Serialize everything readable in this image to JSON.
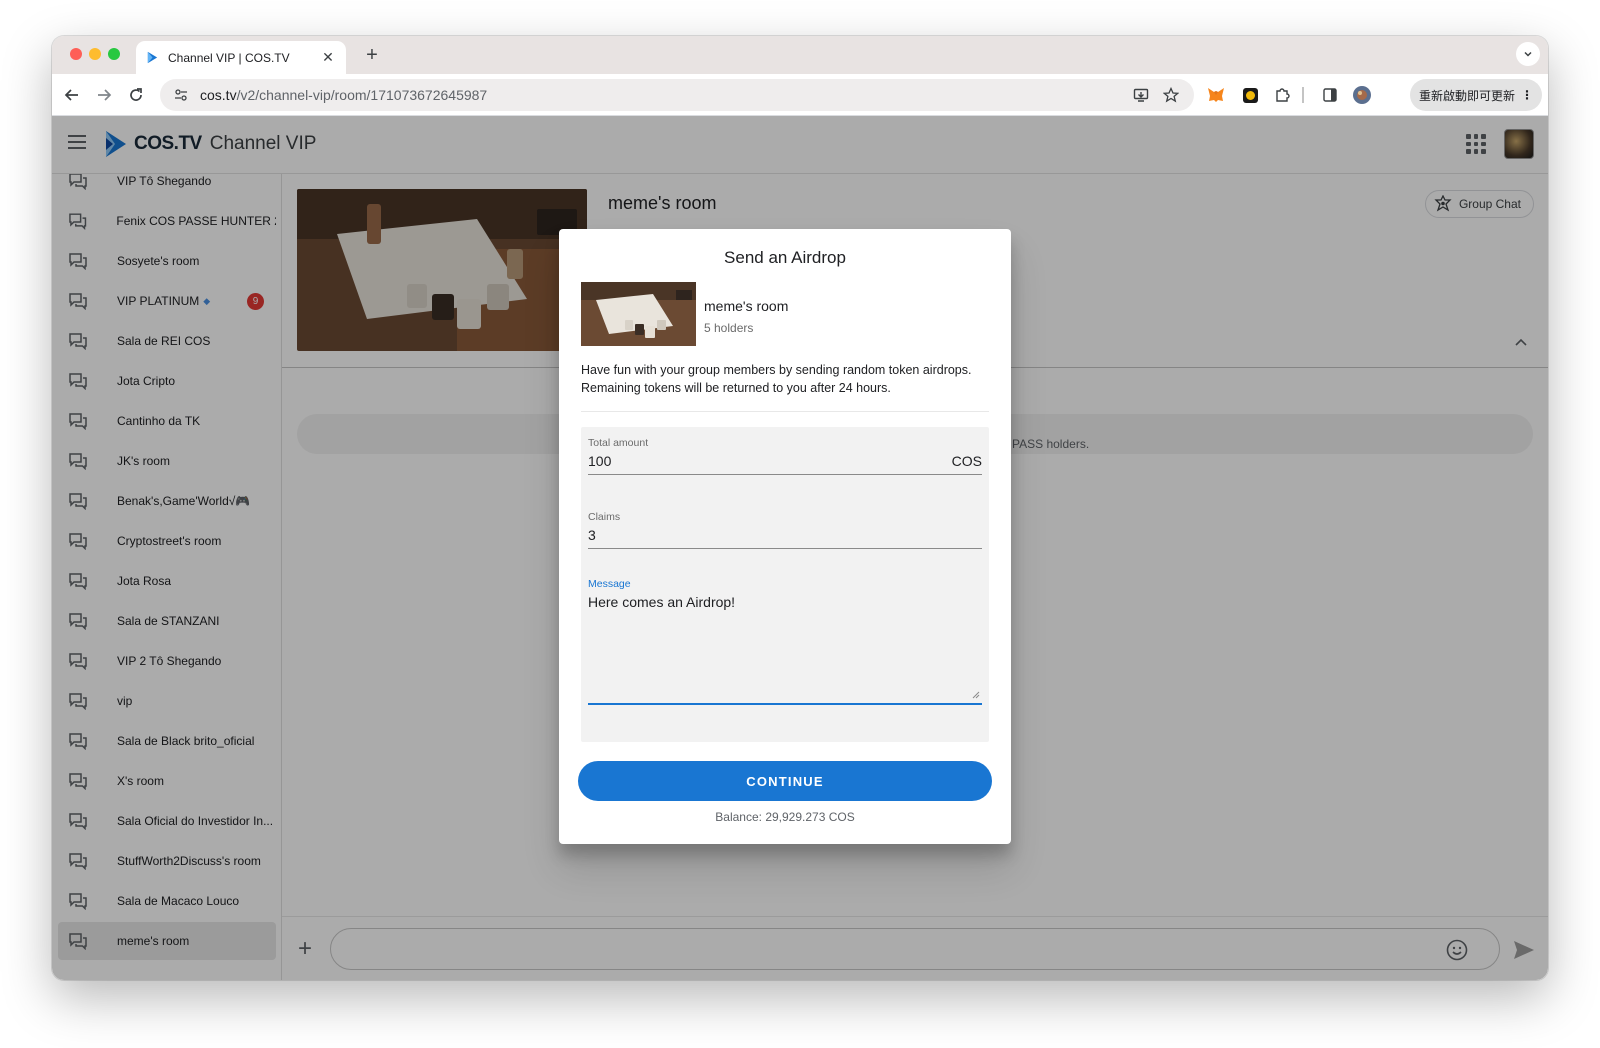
{
  "browser": {
    "tab_title": "Channel VIP | COS.TV",
    "tab_close": "✕",
    "new_tab": "+",
    "url_host": "cos.tv",
    "url_path": "/v2/channel-vip/room/171073672645987",
    "update_button": "重新啟動即可更新",
    "update_menu": "⋮",
    "icons": [
      "back-arrow-icon",
      "forward-arrow-icon",
      "reload-icon",
      "site-info-icon",
      "install-app-icon",
      "bookmark-star-icon",
      "metamask-icon",
      "extension-coin-icon",
      "extensions-puzzle-icon",
      "side-panel-icon",
      "profile-icon"
    ]
  },
  "app": {
    "logo_text": "COS.TV",
    "section_title": "Channel VIP",
    "brand_color": "#1976d2"
  },
  "sidebar": {
    "items": [
      {
        "label": "VIP Tô Shegando"
      },
      {
        "label": "Fenix COS PASSE HUNTER 2"
      },
      {
        "label": "Sosyete's room"
      },
      {
        "label": "VIP PLATINUM",
        "badge": "9",
        "gem": "◆"
      },
      {
        "label": "Sala de REI COS"
      },
      {
        "label": "Jota Cripto"
      },
      {
        "label": "Cantinho da TK"
      },
      {
        "label": "JK's room"
      },
      {
        "label": "Benak's,Game'World√🎮"
      },
      {
        "label": "Cryptostreet's room"
      },
      {
        "label": "Jota Rosa"
      },
      {
        "label": "Sala de STANZANI"
      },
      {
        "label": "VIP 2 Tô Shegando"
      },
      {
        "label": "vip"
      },
      {
        "label": "Sala de Black brito_oficial"
      },
      {
        "label": "X's room"
      },
      {
        "label": "Sala Oficial do Investidor In..."
      },
      {
        "label": "StuffWorth2Discuss's room"
      },
      {
        "label": "Sala de Macaco Louco"
      },
      {
        "label": "meme's room",
        "active": true
      }
    ]
  },
  "room": {
    "title": "meme's room",
    "group_chat_label": "Group Chat",
    "banner_text": "PASS holders."
  },
  "modal": {
    "title": "Send an Airdrop",
    "room_name": "meme's room",
    "holders": "5 holders",
    "description": "Have fun with your group members by sending random token airdrops. Remaining tokens will be returned to you after 24 hours.",
    "total_amount_label": "Total amount",
    "total_amount_value": "100",
    "currency": "COS",
    "claims_label": "Claims",
    "claims_value": "3",
    "message_label": "Message",
    "message_value": "Here comes an Airdrop!",
    "continue_label": "CONTINUE",
    "balance": "Balance: 29,929.273 COS"
  }
}
